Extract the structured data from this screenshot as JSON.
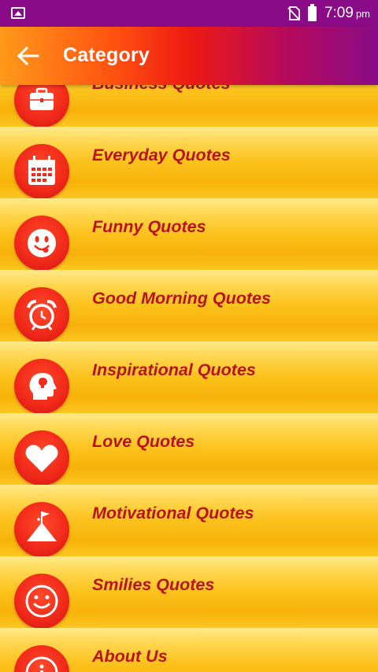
{
  "status_bar": {
    "time": "7:09",
    "ampm": "pm",
    "icons": [
      "image-notification-icon",
      "no-sim-icon",
      "battery-icon"
    ]
  },
  "app_bar": {
    "title": "Category",
    "back_icon": "arrow-left-icon"
  },
  "colors": {
    "status_bar": "#8a0b87",
    "label_text": "#b8141c",
    "icon_circle": "#f22a1a",
    "row_background": "#fcc21c"
  },
  "categories": [
    {
      "label": "Business Quotes",
      "icon": "briefcase-icon"
    },
    {
      "label": "Everyday Quotes",
      "icon": "calendar-icon"
    },
    {
      "label": "Funny Quotes",
      "icon": "funny-face-icon"
    },
    {
      "label": "Good Morning Quotes",
      "icon": "alarm-clock-icon"
    },
    {
      "label": "Inspirational Quotes",
      "icon": "head-idea-icon"
    },
    {
      "label": "Love Quotes",
      "icon": "heart-icon"
    },
    {
      "label": "Motivational Quotes",
      "icon": "mountain-flag-icon"
    },
    {
      "label": "Smilies Quotes",
      "icon": "smiley-icon"
    },
    {
      "label": "About Us",
      "icon": "about-icon"
    }
  ]
}
